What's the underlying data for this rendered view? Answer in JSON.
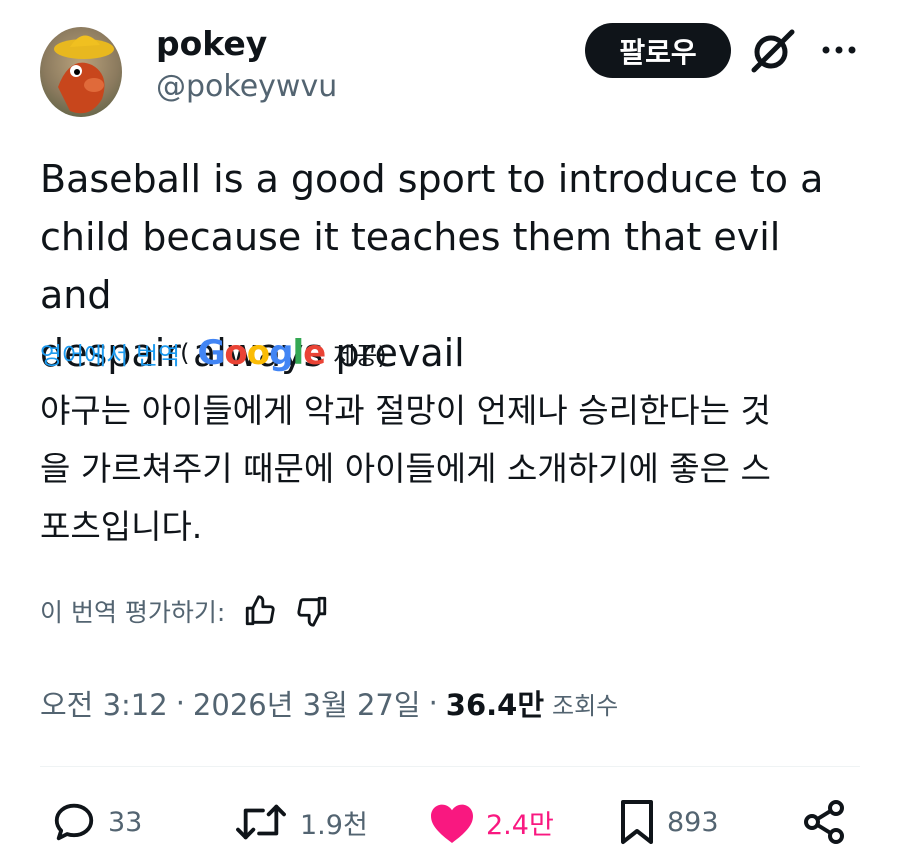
{
  "user": {
    "display_name": "pokey",
    "handle": "@pokeywvu"
  },
  "header": {
    "follow_label": "팔로우",
    "grok_icon": "grok-icon",
    "more_icon": "more-dots-icon"
  },
  "tweet": {
    "text": "Baseball is a good sport to introduce to a\nchild because it teaches them that evil and\ndespair always prevail"
  },
  "translation": {
    "link_label": "영어에서 번역",
    "open_paren": "(",
    "google_logo": "Google",
    "provided_label": "제공)",
    "text": "야구는 아이들에게 악과 절망이 언제나 승리한다는 것\n을 가르쳐주기 때문에 아이들에게 소개하기에 좋은 스\n포츠입니다.",
    "rate_label": "이 번역 평가하기:"
  },
  "meta": {
    "time": "오전 3:12",
    "separator": "·",
    "date": "2026년 3월 27일",
    "views_count": "36.4만",
    "views_label": "조회수"
  },
  "actions": {
    "replies": "33",
    "reposts": "1.9천",
    "likes": "2.4만",
    "bookmarks": "893"
  },
  "colors": {
    "accent_blue": "#1d9bf0",
    "like_pink": "#f91880",
    "text_primary": "#0f1419",
    "text_secondary": "#536471",
    "follow_bg": "#0f1419"
  }
}
